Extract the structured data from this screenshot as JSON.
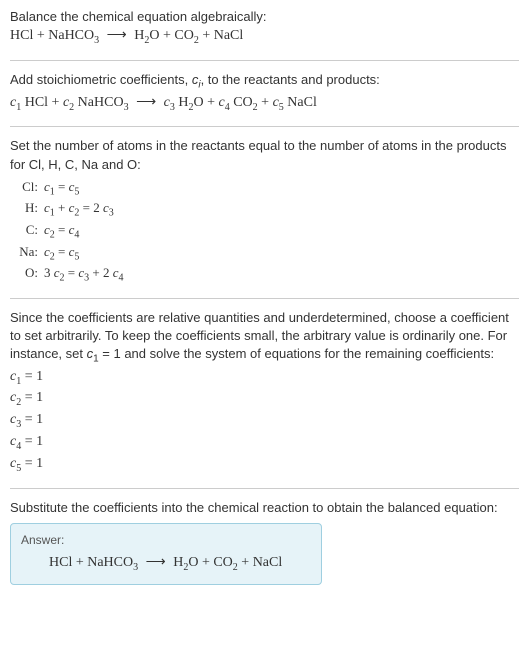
{
  "section1": {
    "title": "Balance the chemical equation algebraically:",
    "eq_parts": {
      "r1": "HCl",
      "plus1": " + ",
      "r2": "NaHCO",
      "r2sub": "3",
      "arrow": " ⟶ ",
      "p1": "H",
      "p1sub": "2",
      "p1b": "O",
      "plus2": " + ",
      "p2": "CO",
      "p2sub": "2",
      "plus3": " + ",
      "p3": "NaCl"
    }
  },
  "section2": {
    "text_a": "Add stoichiometric coefficients, ",
    "ci": "c",
    "ci_sub": "i",
    "text_b": ", to the reactants and products:",
    "eq": {
      "c1": "c",
      "c1s": "1",
      "sp1": " HCl + ",
      "c2": "c",
      "c2s": "2",
      "sp2": " NaHCO",
      "sp2sub": "3",
      "arrow": " ⟶ ",
      "c3": "c",
      "c3s": "3",
      "sp3": " H",
      "sp3sub": "2",
      "sp3b": "O + ",
      "c4": "c",
      "c4s": "4",
      "sp4": " CO",
      "sp4sub": "2",
      "sp4b": " + ",
      "c5": "c",
      "c5s": "5",
      "sp5": " NaCl"
    }
  },
  "section3": {
    "intro": "Set the number of atoms in the reactants equal to the number of atoms in the products for Cl, H, C, Na and O:",
    "rows": [
      {
        "label": "Cl:",
        "c_a": "c",
        "s_a": "1",
        "mid": " = ",
        "c_b": "c",
        "s_b": "5",
        "tail": ""
      },
      {
        "label": "H:",
        "c_a": "c",
        "s_a": "1",
        "mid": " + ",
        "c_b": "c",
        "s_b": "2",
        "tail_a": " = 2 ",
        "c_c": "c",
        "s_c": "3"
      },
      {
        "label": "C:",
        "c_a": "c",
        "s_a": "2",
        "mid": " = ",
        "c_b": "c",
        "s_b": "4",
        "tail": ""
      },
      {
        "label": "Na:",
        "c_a": "c",
        "s_a": "2",
        "mid": " = ",
        "c_b": "c",
        "s_b": "5",
        "tail": ""
      },
      {
        "label": "O:",
        "pre": "3 ",
        "c_a": "c",
        "s_a": "2",
        "mid": " = ",
        "c_b": "c",
        "s_b": "3",
        "tail_a": " + 2 ",
        "c_c": "c",
        "s_c": "4"
      }
    ]
  },
  "section4": {
    "text_a": "Since the coefficients are relative quantities and underdetermined, choose a coefficient to set arbitrarily. To keep the coefficients small, the arbitrary value is ordinarily one. For instance, set ",
    "c1": "c",
    "c1s": "1",
    "text_b": " = 1 and solve the system of equations for the remaining coefficients:",
    "coeffs": [
      {
        "c": "c",
        "s": "1",
        "v": " = 1"
      },
      {
        "c": "c",
        "s": "2",
        "v": " = 1"
      },
      {
        "c": "c",
        "s": "3",
        "v": " = 1"
      },
      {
        "c": "c",
        "s": "4",
        "v": " = 1"
      },
      {
        "c": "c",
        "s": "5",
        "v": " = 1"
      }
    ]
  },
  "section5": {
    "text": "Substitute the coefficients into the chemical reaction to obtain the balanced equation:",
    "answer_label": "Answer:",
    "eq": {
      "r1": "HCl + NaHCO",
      "r1sub": "3",
      "arrow": " ⟶ ",
      "p1": "H",
      "p1sub": "2",
      "p1b": "O + CO",
      "p2sub": "2",
      "p2b": " + NaCl"
    }
  }
}
